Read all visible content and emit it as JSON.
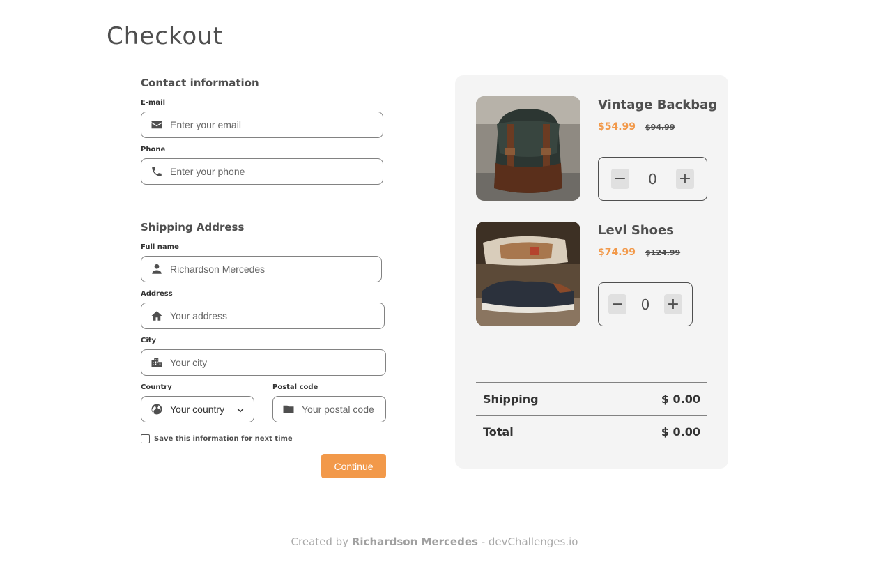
{
  "page": {
    "title": "Checkout"
  },
  "contact": {
    "title": "Contact information",
    "email_label": "E-mail",
    "email_placeholder": "Enter your email",
    "phone_label": "Phone",
    "phone_placeholder": "Enter your phone"
  },
  "shipping": {
    "title": "Shipping Address",
    "fullname_label": "Full name",
    "fullname_placeholder": "Richardson Mercedes",
    "address_label": "Address",
    "address_placeholder": "Your address",
    "city_label": "City",
    "city_placeholder": "Your city",
    "country_label": "Country",
    "country_value": "Your country",
    "postal_label": "Postal code",
    "postal_placeholder": "Your postal code",
    "save_label": "Save this information for next time",
    "continue_label": "Continue"
  },
  "cart": {
    "items": [
      {
        "name": "Vintage Backbag",
        "price": "$54.99",
        "old_price": "$94.99",
        "quantity": "0",
        "minus": "−",
        "plus": "+"
      },
      {
        "name": "Levi Shoes",
        "price": "$74.99",
        "old_price": "$124.99",
        "quantity": "0",
        "minus": "−",
        "plus": "+"
      }
    ],
    "shipping_label": "Shipping",
    "shipping_value": "$ 0.00",
    "total_label": "Total",
    "total_value": "$ 0.00"
  },
  "footer": {
    "prefix": "Created by",
    "author": "Richardson Mercedes",
    "suffix": "- devChallenges.io"
  },
  "colors": {
    "accent": "#f2994a",
    "text": "#4f4f4f",
    "panel": "#f4f4f4"
  },
  "icons": [
    "envelope-icon",
    "phone-icon",
    "user-icon",
    "home-icon",
    "city-icon",
    "globe-icon",
    "chevron-down-icon",
    "folder-icon"
  ]
}
